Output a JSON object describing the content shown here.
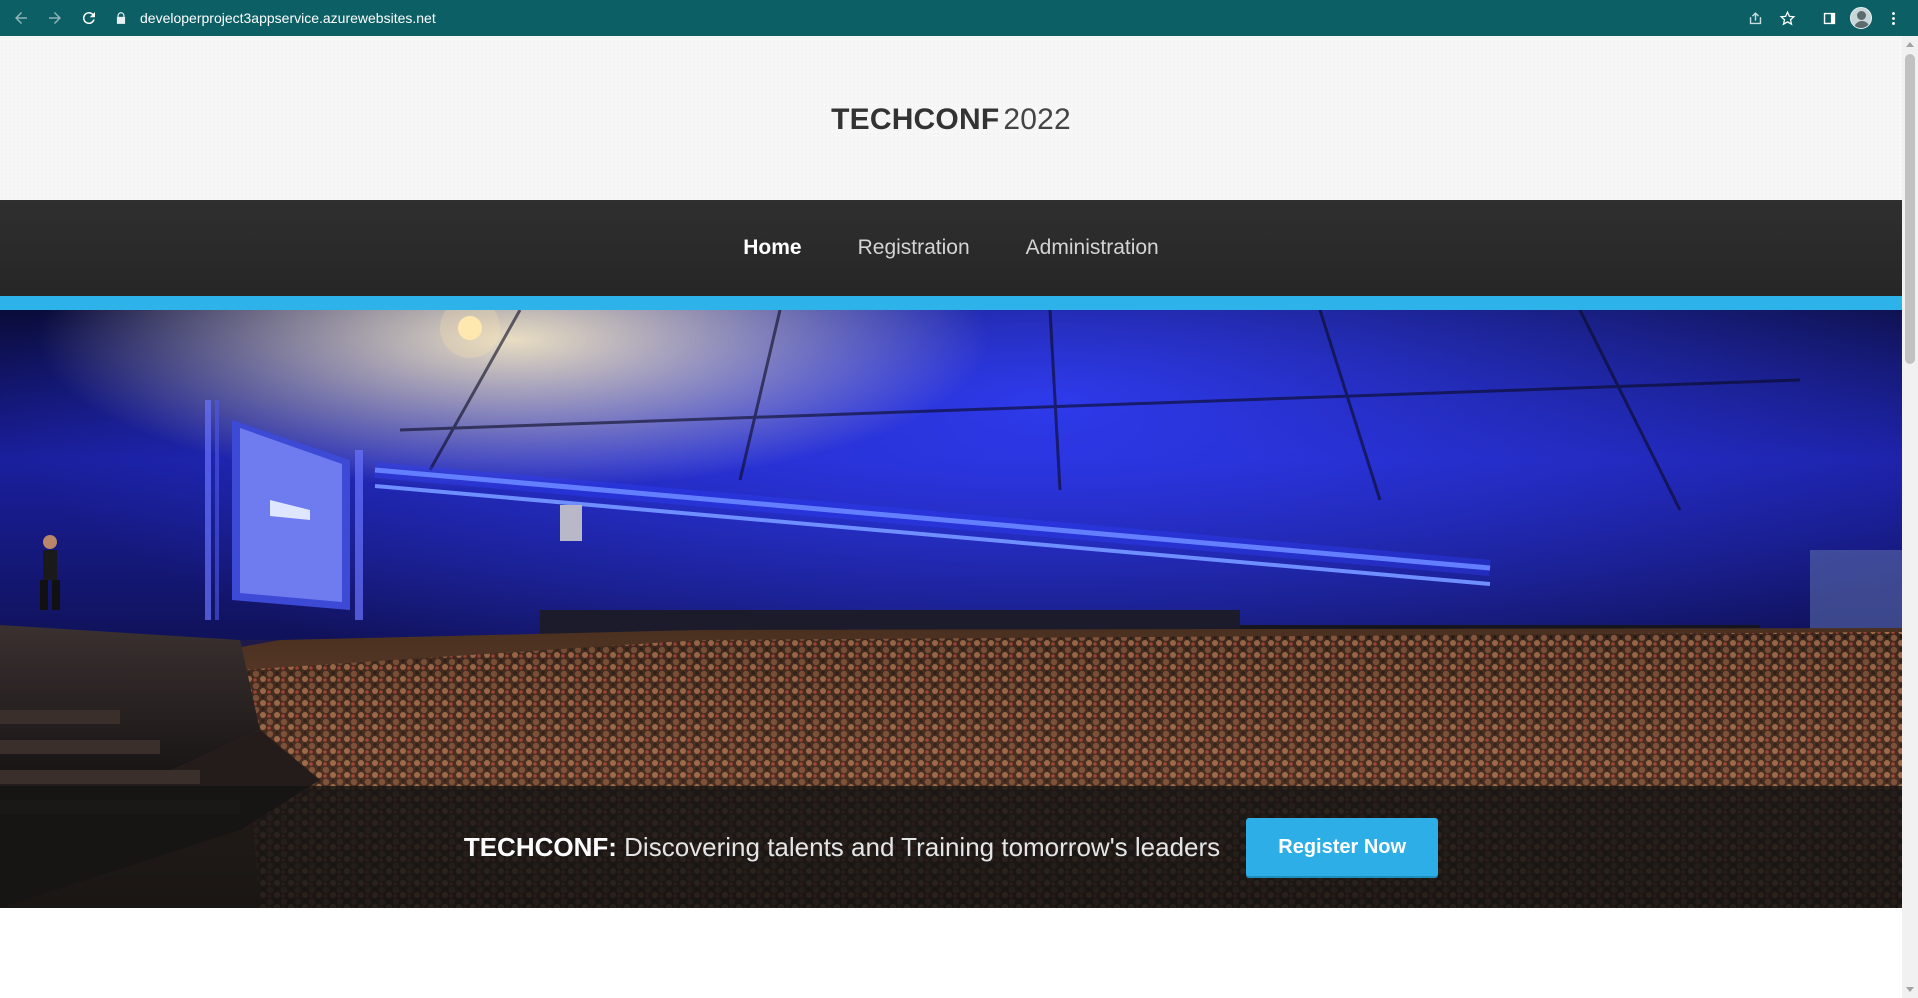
{
  "browser": {
    "url": "developerproject3appservice.azurewebsites.net"
  },
  "header": {
    "brand": "TECHCONF",
    "year": "2022"
  },
  "nav": {
    "items": [
      {
        "label": "Home",
        "active": true
      },
      {
        "label": "Registration",
        "active": false
      },
      {
        "label": "Administration",
        "active": false
      }
    ]
  },
  "hero": {
    "tagline_strong": "TECHCONF:",
    "tagline_text": "Discovering talents and Training tomorrow's leaders",
    "cta_label": "Register Now"
  },
  "colors": {
    "accent": "#2eb2ea",
    "nav_bg": "#2b2b2b",
    "chrome": "#0d5f66"
  },
  "icons": {
    "back": "arrow-left-icon",
    "forward": "arrow-right-icon",
    "reload": "reload-icon",
    "lock": "lock-icon",
    "share": "share-icon",
    "bookmark": "star-icon",
    "side_panel": "side-panel-icon",
    "profile": "avatar",
    "menu": "kebab-menu-icon"
  }
}
